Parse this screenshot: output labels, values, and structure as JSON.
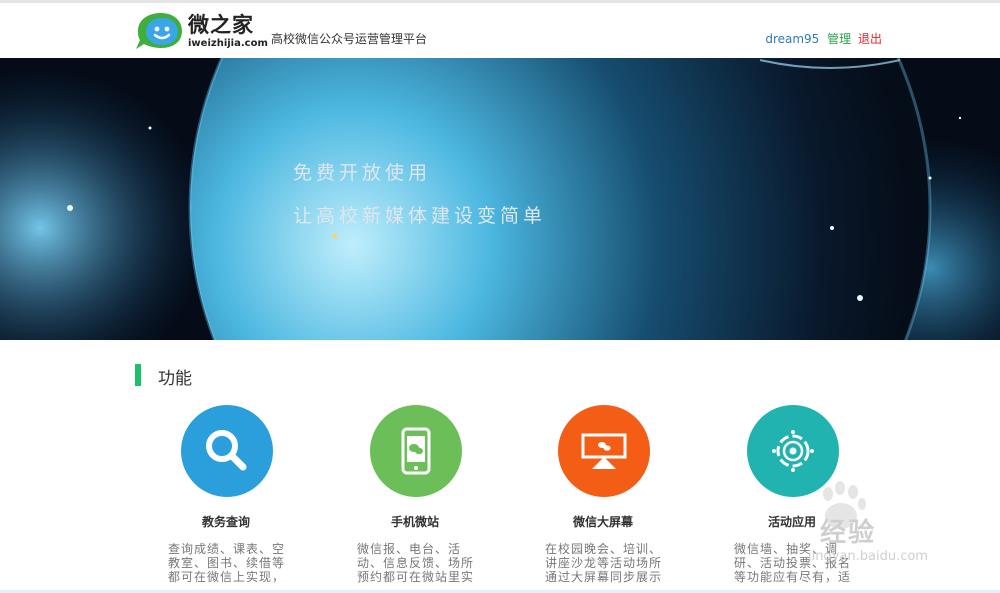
{
  "header": {
    "logo_cn": "微之家",
    "logo_en": "iweizhijia.com",
    "slogan": "高校微信公众号运营管理平台",
    "username": "dream95",
    "manage_label": "管理",
    "logout_label": "退出"
  },
  "banner": {
    "line1": "免费开放使用",
    "line2": "让高校新媒体建设变简单"
  },
  "section": {
    "title": "功能"
  },
  "features": [
    {
      "icon": "magnifier-icon",
      "color": "#2a9fdc",
      "title": "教务查询",
      "desc": "查询成绩、课表、空教室、图书、续借等都可在微信上实现，"
    },
    {
      "icon": "phone-wechat-icon",
      "color": "#6cbe58",
      "title": "手机微站",
      "desc": "微信报、电台、活动、信息反馈、场所预约都可在微站里实"
    },
    {
      "icon": "screen-icon",
      "color": "#f35d16",
      "title": "微信大屏幕",
      "desc": "在校园晚会、培训、讲座沙龙等活动场所通过大屏幕同步展示"
    },
    {
      "icon": "target-icon",
      "color": "#20b3b0",
      "title": "活动应用",
      "desc": "微信墙、抽奖、调研、活动投票、报名等功能应有尽有，适"
    }
  ],
  "watermark": {
    "text": "经验",
    "url": "jingyan.baidu.com"
  },
  "colors": {
    "accent": "#1cc26a",
    "link": "#2f7ab7",
    "manage": "#2aa34a",
    "logout": "#e0262e"
  }
}
